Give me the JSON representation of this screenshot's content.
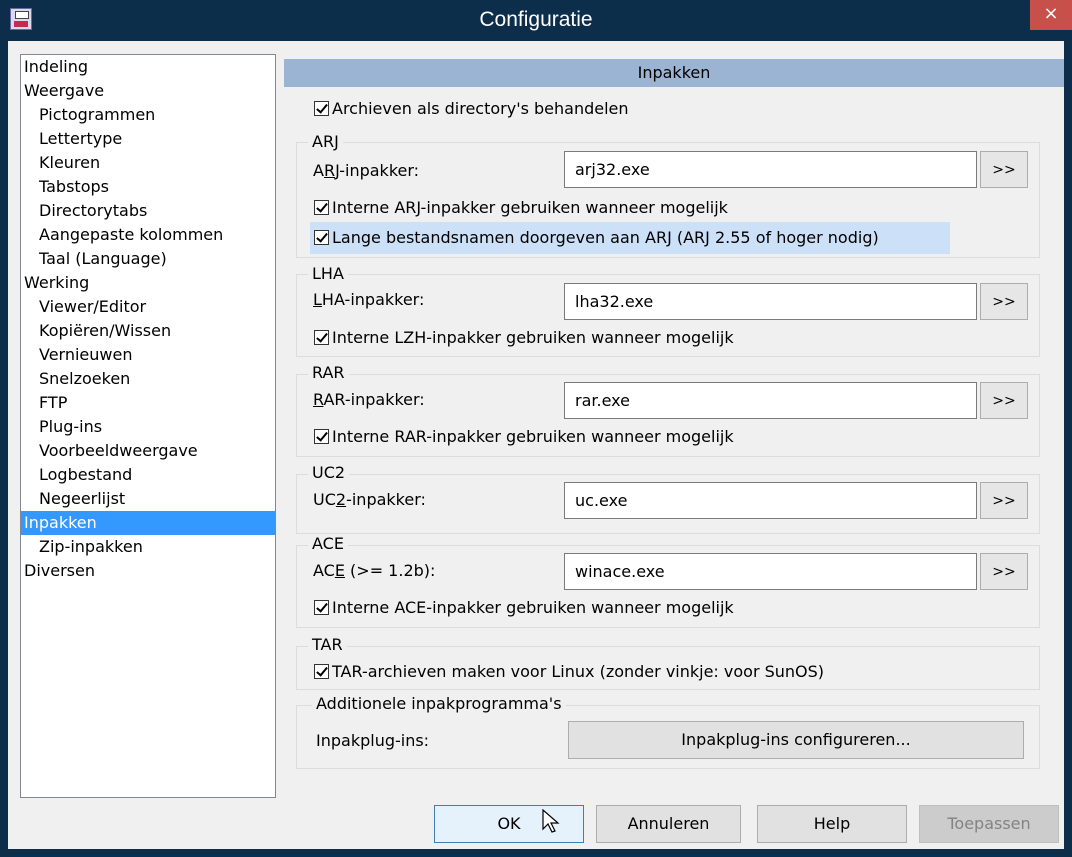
{
  "window": {
    "title": "Configuratie",
    "close_label": "×"
  },
  "nav": {
    "items": [
      {
        "label": "Indeling",
        "level": 0
      },
      {
        "label": "Weergave",
        "level": 0
      },
      {
        "label": "Pictogrammen",
        "level": 1
      },
      {
        "label": "Lettertype",
        "level": 1
      },
      {
        "label": "Kleuren",
        "level": 1
      },
      {
        "label": "Tabstops",
        "level": 1
      },
      {
        "label": "Directorytabs",
        "level": 1
      },
      {
        "label": "Aangepaste kolommen",
        "level": 1
      },
      {
        "label": "Taal (Language)",
        "level": 1
      },
      {
        "label": "Werking",
        "level": 0
      },
      {
        "label": "Viewer/Editor",
        "level": 1
      },
      {
        "label": "Kopiëren/Wissen",
        "level": 1
      },
      {
        "label": "Vernieuwen",
        "level": 1
      },
      {
        "label": "Snelzoeken",
        "level": 1
      },
      {
        "label": "FTP",
        "level": 1
      },
      {
        "label": "Plug-ins",
        "level": 1
      },
      {
        "label": "Voorbeeldweergave",
        "level": 1
      },
      {
        "label": "Logbestand",
        "level": 1
      },
      {
        "label": "Negeerlijst",
        "level": 1
      },
      {
        "label": "Inpakken",
        "level": 0,
        "selected": true
      },
      {
        "label": "Zip-inpakken",
        "level": 1
      },
      {
        "label": "Diversen",
        "level": 0
      }
    ]
  },
  "panel": {
    "heading": "Inpakken",
    "archives_as_dirs": "Archieven als directory's behandelen",
    "arj": {
      "title": "ARJ",
      "packer_label_pre": "A",
      "packer_label_u": "R",
      "packer_label_post": "J-inpakker:",
      "packer_value": "arj32.exe",
      "browse": ">>",
      "internal": "Interne ARJ-inpakker gebruiken wanneer mogelijk",
      "long_names": "Lange bestandsnamen doorgeven aan ARJ (ARJ 2.55 of hoger nodig)"
    },
    "lha": {
      "title": "LHA",
      "packer_label_u": "L",
      "packer_label_post": "HA-inpakker:",
      "packer_value": "lha32.exe",
      "browse": ">>",
      "internal": "Interne LZH-inpakker gebruiken wanneer mogelijk"
    },
    "rar": {
      "title": "RAR",
      "packer_label_u": "R",
      "packer_label_post": "AR-inpakker:",
      "packer_value": "rar.exe",
      "browse": ">>",
      "internal": "Interne RAR-inpakker gebruiken wanneer mogelijk"
    },
    "uc2": {
      "title": "UC2",
      "packer_label_pre": "UC",
      "packer_label_u": "2",
      "packer_label_post": "-inpakker:",
      "packer_value": "uc.exe",
      "browse": ">>"
    },
    "ace": {
      "title": "ACE",
      "packer_label_pre": "AC",
      "packer_label_u": "E",
      "packer_label_post": " (>= 1.2b):",
      "packer_value": "winace.exe",
      "browse": ">>",
      "internal": "Interne ACE-inpakker gebruiken wanneer mogelijk"
    },
    "tar": {
      "title": "TAR",
      "linux": "TAR-archieven maken voor Linux (zonder vinkje: voor SunOS)"
    },
    "additional": {
      "title": "Additionele inpakprogramma's",
      "plugins_label": "Inpakplug-ins:",
      "configure_button": "Inpakplug-ins configureren..."
    }
  },
  "buttons": {
    "ok": "OK",
    "cancel": "Annuleren",
    "help": "Help",
    "apply": "Toepassen"
  }
}
